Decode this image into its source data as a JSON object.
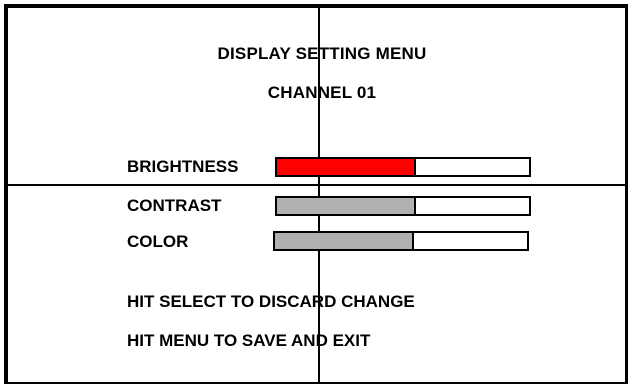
{
  "menu": {
    "title": "DISPLAY SETTING MENU",
    "channel": "CHANNEL 01"
  },
  "settings": [
    {
      "label": "BRIGHTNESS",
      "level": 0.55,
      "fill_color": "#ff0000",
      "selected": true
    },
    {
      "label": "CONTRAST",
      "level": 0.55,
      "fill_color": "#b0b0b0",
      "selected": false
    },
    {
      "label": "COLOR",
      "level": 0.55,
      "fill_color": "#b0b0b0",
      "selected": false
    }
  ],
  "instructions": {
    "discard": "HIT SELECT TO DISCARD CHANGE",
    "save": "HIT MENU TO SAVE AND EXIT"
  },
  "colors": {
    "background": "#ffffff",
    "frame": "#000000",
    "selected_bar": "#ff0000",
    "unselected_bar": "#b0b0b0"
  }
}
